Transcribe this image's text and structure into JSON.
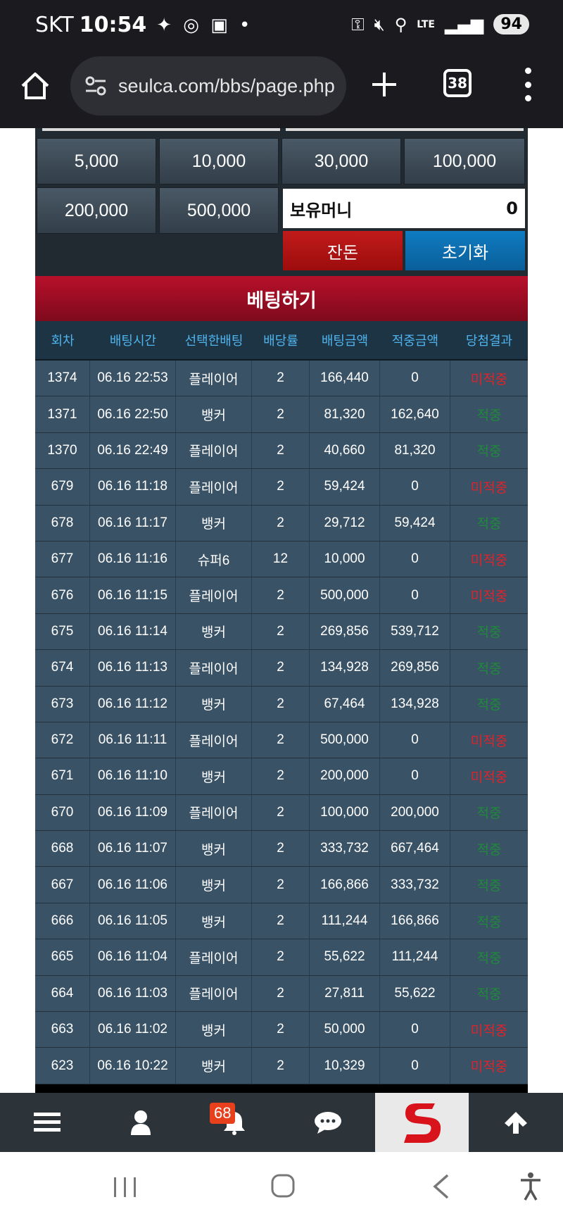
{
  "status_bar": {
    "carrier": "SKT",
    "time": "10:54",
    "battery": "94",
    "network": "LTE"
  },
  "browser": {
    "url": "seulca.com/bbs/page.php",
    "tab_count": "38"
  },
  "amount_buttons": [
    "5,000",
    "10,000",
    "30,000",
    "100,000",
    "200,000",
    "500,000"
  ],
  "money": {
    "label": "보유머니",
    "value": "0"
  },
  "actions": {
    "all_in": "잔돈",
    "reset": "초기화"
  },
  "bet_title": "베팅하기",
  "table": {
    "headers": [
      "회차",
      "배팅시간",
      "선택한배팅",
      "배당률",
      "배팅금액",
      "적중금액",
      "당첨결과"
    ],
    "rows": [
      [
        "1374",
        "06.16 22:53",
        "플레이어",
        "2",
        "166,440",
        "0",
        "미적중"
      ],
      [
        "1371",
        "06.16 22:50",
        "뱅커",
        "2",
        "81,320",
        "162,640",
        "적중"
      ],
      [
        "1370",
        "06.16 22:49",
        "플레이어",
        "2",
        "40,660",
        "81,320",
        "적중"
      ],
      [
        "679",
        "06.16 11:18",
        "플레이어",
        "2",
        "59,424",
        "0",
        "미적중"
      ],
      [
        "678",
        "06.16 11:17",
        "뱅커",
        "2",
        "29,712",
        "59,424",
        "적중"
      ],
      [
        "677",
        "06.16 11:16",
        "슈퍼6",
        "12",
        "10,000",
        "0",
        "미적중"
      ],
      [
        "676",
        "06.16 11:15",
        "플레이어",
        "2",
        "500,000",
        "0",
        "미적중"
      ],
      [
        "675",
        "06.16 11:14",
        "뱅커",
        "2",
        "269,856",
        "539,712",
        "적중"
      ],
      [
        "674",
        "06.16 11:13",
        "플레이어",
        "2",
        "134,928",
        "269,856",
        "적중"
      ],
      [
        "673",
        "06.16 11:12",
        "뱅커",
        "2",
        "67,464",
        "134,928",
        "적중"
      ],
      [
        "672",
        "06.16 11:11",
        "플레이어",
        "2",
        "500,000",
        "0",
        "미적중"
      ],
      [
        "671",
        "06.16 11:10",
        "뱅커",
        "2",
        "200,000",
        "0",
        "미적중"
      ],
      [
        "670",
        "06.16 11:09",
        "플레이어",
        "2",
        "100,000",
        "200,000",
        "적중"
      ],
      [
        "668",
        "06.16 11:07",
        "뱅커",
        "2",
        "333,732",
        "667,464",
        "적중"
      ],
      [
        "667",
        "06.16 11:06",
        "뱅커",
        "2",
        "166,866",
        "333,732",
        "적중"
      ],
      [
        "666",
        "06.16 11:05",
        "뱅커",
        "2",
        "111,244",
        "166,866",
        "적중"
      ],
      [
        "665",
        "06.16 11:04",
        "플레이어",
        "2",
        "55,622",
        "111,244",
        "적중"
      ],
      [
        "664",
        "06.16 11:03",
        "플레이어",
        "2",
        "27,811",
        "55,622",
        "적중"
      ],
      [
        "663",
        "06.16 11:02",
        "뱅커",
        "2",
        "50,000",
        "0",
        "미적중"
      ],
      [
        "623",
        "06.16 10:22",
        "뱅커",
        "2",
        "10,329",
        "0",
        "미적중"
      ]
    ]
  },
  "bottom_nav": {
    "items": [
      "menu-icon",
      "user-icon",
      "bell-icon",
      "chat-icon",
      "brand-logo",
      "arrow-up-icon"
    ],
    "notification_count": "68"
  },
  "colors": {
    "win": "#1e8a3a",
    "lose": "#e0222a",
    "header_text": "#4fb4ee",
    "bet_header": "#9d0c22"
  }
}
